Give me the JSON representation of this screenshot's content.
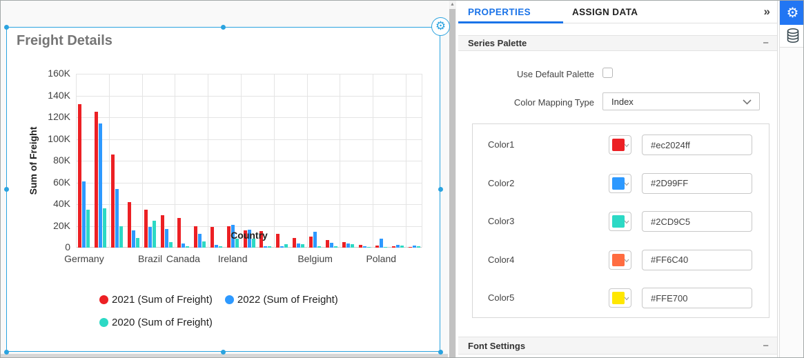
{
  "canvas": {
    "widget_title": "Freight Details"
  },
  "chart_data": {
    "type": "bar",
    "title": "Freight Details",
    "xlabel": "Country",
    "ylabel": "Sum of Freight",
    "ylim": [
      0,
      160000
    ],
    "grid": true,
    "legend_position": "bottom",
    "y_ticks": [
      "0",
      "20K",
      "40K",
      "60K",
      "80K",
      "100K",
      "120K",
      "140K",
      "160K"
    ],
    "categories": [
      "Germany",
      "",
      "",
      "",
      "Brazil",
      "",
      "Canada",
      "",
      "",
      "Ireland",
      "",
      "",
      "",
      "",
      "Belgium",
      "",
      "",
      "",
      "Poland",
      "",
      ""
    ],
    "visible_x_labels": [
      "Germany",
      "Brazil",
      "Canada",
      "Ireland",
      "Belgium",
      "Poland"
    ],
    "series": [
      {
        "name": "2021 (Sum of Freight)",
        "color": "#ec2024",
        "values": [
          132000,
          125000,
          86000,
          42000,
          35000,
          30000,
          27000,
          20000,
          19000,
          20000,
          16000,
          15000,
          13000,
          9000,
          10000,
          7000,
          5000,
          2500,
          2000,
          1000,
          800
        ]
      },
      {
        "name": "2022 (Sum of Freight)",
        "color": "#2D99FF",
        "values": [
          61000,
          114000,
          54000,
          16000,
          19000,
          17000,
          4000,
          13000,
          2500,
          21000,
          16500,
          1500,
          1500,
          4000,
          14500,
          4500,
          4000,
          1000,
          8500,
          2500,
          2000
        ]
      },
      {
        "name": "2020 (Sum of Freight)",
        "color": "#2CD9C5",
        "values": [
          35000,
          36000,
          20000,
          9000,
          25000,
          5000,
          1500,
          6000,
          1000,
          8000,
          8000,
          1000,
          3000,
          3500,
          1000,
          1000,
          3500,
          500,
          500,
          2000,
          1500
        ]
      }
    ]
  },
  "panel": {
    "tabs": [
      {
        "label": "PROPERTIES",
        "active": true
      },
      {
        "label": "ASSIGN DATA",
        "active": false
      }
    ],
    "collapse_panel_icon": "»",
    "series_palette": {
      "title": "Series Palette",
      "collapse_icon": "−",
      "use_default_palette": {
        "label": "Use Default Palette",
        "checked": false
      },
      "color_mapping": {
        "label": "Color Mapping Type",
        "value": "Index"
      },
      "colors": [
        {
          "label": "Color1",
          "swatch": "#ec2024",
          "hex": "#ec2024ff"
        },
        {
          "label": "Color2",
          "swatch": "#2D99FF",
          "hex": "#2D99FF"
        },
        {
          "label": "Color3",
          "swatch": "#2CD9C5",
          "hex": "#2CD9C5"
        },
        {
          "label": "Color4",
          "swatch": "#FF6C40",
          "hex": "#FF6C40"
        },
        {
          "label": "Color5",
          "swatch": "#FFE700",
          "hex": "#FFE700"
        }
      ]
    },
    "font_settings": {
      "title": "Font Settings",
      "collapse_icon": "−"
    }
  },
  "toolbar": {
    "items": [
      {
        "icon": "gear-icon",
        "active": true
      },
      {
        "icon": "database-icon",
        "active": false
      }
    ]
  },
  "colors": {
    "accent_blue": "#1a73e8",
    "toolbar_blue": "#2276f3",
    "selection_blue": "#2ba3df",
    "title_gray": "#757575"
  }
}
